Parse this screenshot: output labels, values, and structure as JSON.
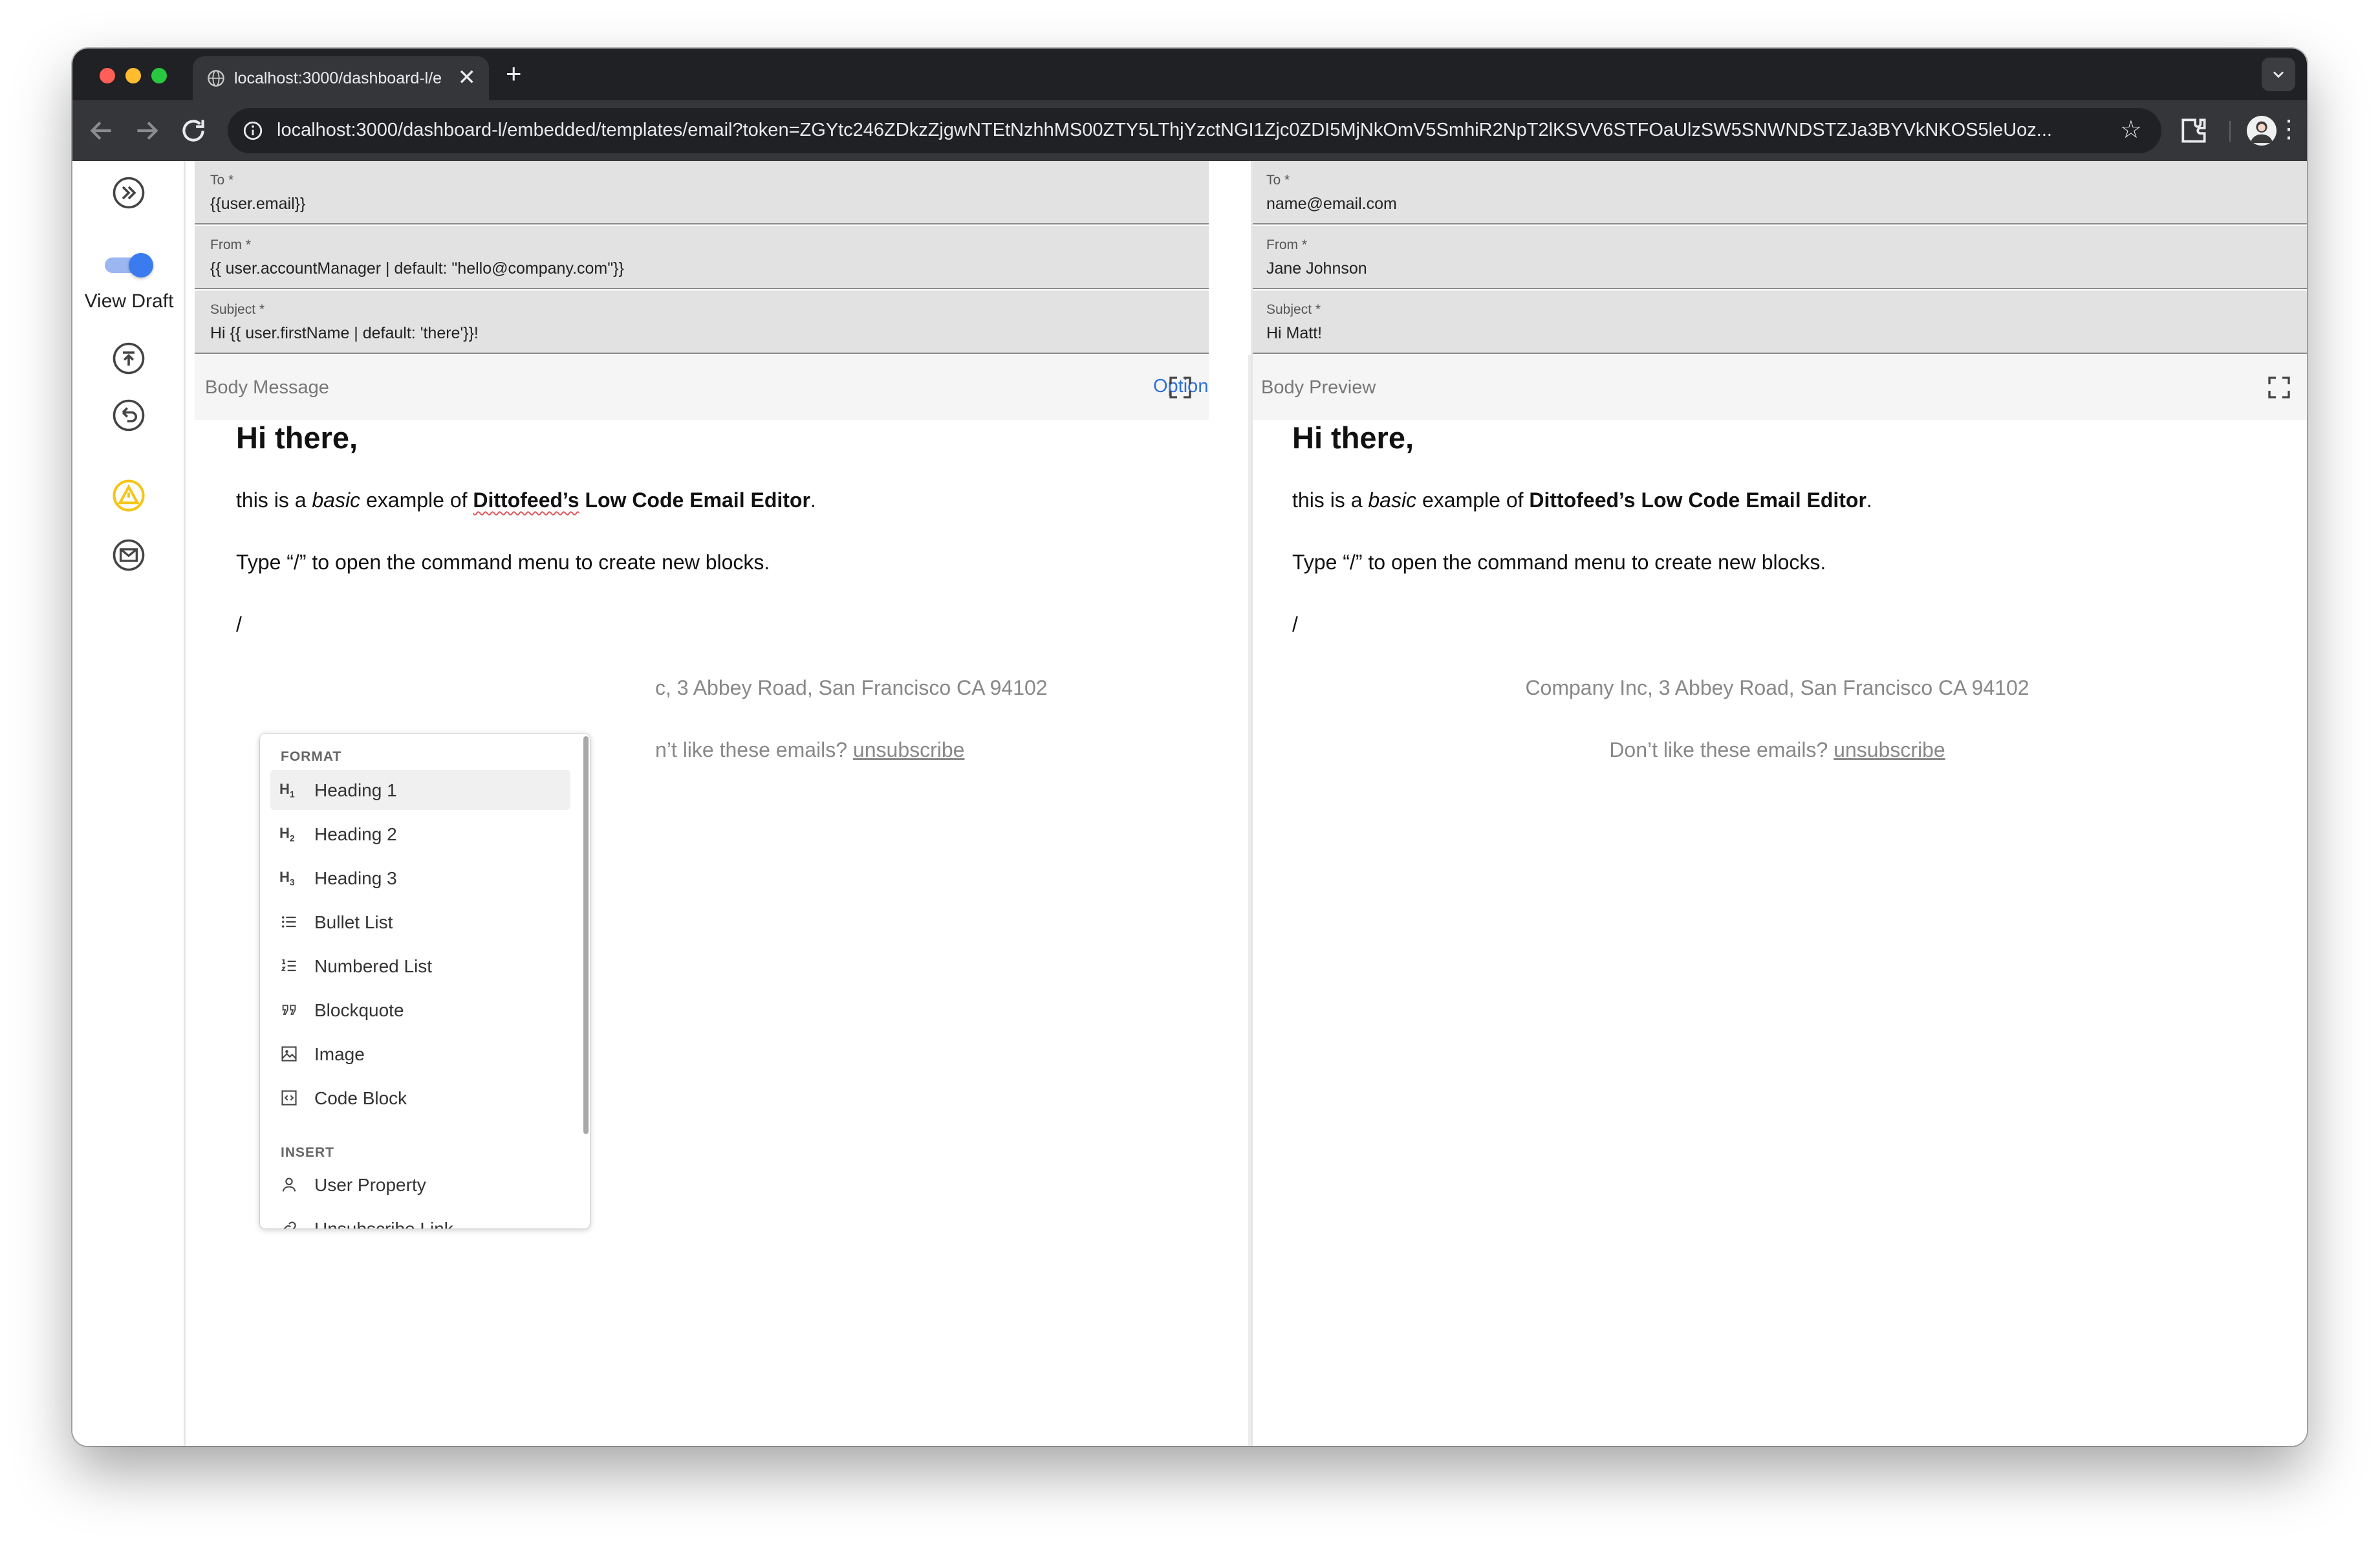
{
  "browser": {
    "tab_title": "localhost:3000/dashboard-l/e",
    "new_tab_label": "+",
    "close_tab_label": "✕",
    "url": "localhost:3000/dashboard-l/embedded/templates/email?token=ZGYtc246ZDkzZjgwNTEtNzhhMS00ZTY5LThjYzctNGI1Zjc0ZDI5MjNkOmV5SmhiR2NpT2lKSVV6STFOaUlzSW5SNWNDSTZJa3BYVkNKOS5leUoz...",
    "colors": {
      "close": "#ff5f57",
      "minimize": "#febc2e",
      "zoom": "#28c840"
    }
  },
  "rail": {
    "view_draft_label": "View Draft",
    "toggle_on": true,
    "accent": "#3b7bf0",
    "warning_color": "#f5c518"
  },
  "editor": {
    "to_label": "To *",
    "to_value": "{{user.email}}",
    "from_label": "From *",
    "from_value": "{{ user.accountManager | default: \"hello@company.com\"}}",
    "subject_label": "Subject *",
    "subject_value": "Hi {{ user.firstName | default: 'there'}}!",
    "body_label": "Body Message",
    "options_label": "Options",
    "more_label": "...",
    "heading": "Hi there,",
    "line1_a": "this is a ",
    "line1_em": "basic",
    "line1_b": " example of ",
    "line1_strong_a": "Dittofeed’s",
    "line1_strong_b": " Low Code Email Editor",
    "line1_end": ".",
    "line2": "Type “/” to open the command menu to create new blocks.",
    "slash": "/",
    "footer_address_partial": "c, 3 Abbey Road, San Francisco CA 94102",
    "footer_unsub_partial_prefix": "n’t like these emails? ",
    "footer_unsub_link": "unsubscribe"
  },
  "preview": {
    "to_label": "To *",
    "to_value": "name@email.com",
    "from_label": "From *",
    "from_value": "Jane Johnson",
    "subject_label": "Subject *",
    "subject_value": "Hi Matt!",
    "body_label": "Body Preview",
    "heading": "Hi there,",
    "line1_a": "this is a ",
    "line1_em": "basic",
    "line1_b": " example of ",
    "line1_strong": "Dittofeed’s Low Code Email Editor",
    "line1_end": ".",
    "line2": "Type “/” to open the command menu to create new blocks.",
    "slash": "/",
    "footer_address": "Company Inc, 3 Abbey Road, San Francisco CA 94102",
    "footer_unsub_prefix": "Don’t like these emails? ",
    "footer_unsub_link": "unsubscribe"
  },
  "slash_menu": {
    "format_header": "FORMAT",
    "insert_header": "INSERT",
    "items": [
      {
        "label": "Heading 1",
        "icon": "H1",
        "active": true
      },
      {
        "label": "Heading 2",
        "icon": "H2"
      },
      {
        "label": "Heading 3",
        "icon": "H3"
      },
      {
        "label": "Bullet List",
        "icon": "bullet-list-icon"
      },
      {
        "label": "Numbered List",
        "icon": "numbered-list-icon"
      },
      {
        "label": "Blockquote",
        "icon": "quote-icon"
      },
      {
        "label": "Image",
        "icon": "image-icon"
      },
      {
        "label": "Code Block",
        "icon": "code-block-icon"
      }
    ],
    "insert_items": [
      {
        "label": "User Property",
        "icon": "user-icon"
      },
      {
        "label": "Unsubscribe Link",
        "icon": "link-icon"
      }
    ]
  }
}
